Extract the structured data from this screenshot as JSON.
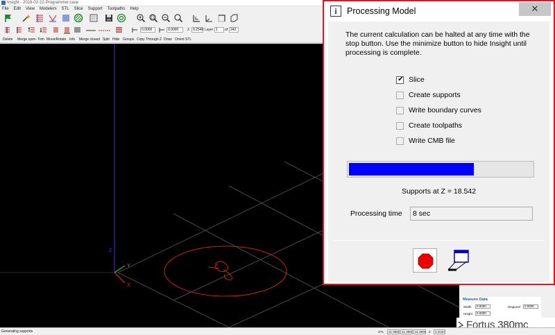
{
  "app": {
    "title": "Insight - 2018-02-22-Programmer.case",
    "menu": [
      "File",
      "Edit",
      "View",
      "Modelers",
      "STL",
      "Slice",
      "Support",
      "Toolpaths",
      "Help"
    ],
    "toolbar2": {
      "field1": "0.0000",
      "field2": "0.0000",
      "z_label": "Z",
      "z_value": "0.2540",
      "layer_label": "Layer",
      "layer_value": "1",
      "of_label": "of",
      "of_value": "242"
    },
    "toolbar3": [
      "Delete",
      "Merge open",
      "Trim",
      "Move/Rotate",
      "Info",
      "Merge closed",
      "Split",
      "Hide",
      "Groups",
      "Copy Through Z",
      "Draw",
      "Orient STL"
    ],
    "viewport": {
      "axis_x": "X",
      "axis_y": "Y",
      "axis_z": "Z",
      "colors": {
        "background": "#000000",
        "grid": "#5a5a5a",
        "part": "#cc1f1f",
        "axis_x": "#d12a2a",
        "axis_y": "#28c428",
        "axis_z": "#2f3fd8"
      }
    },
    "status": {
      "text": "Generating supports",
      "stl_label": "STL",
      "v1": "31.9980",
      "v2": "31.9980",
      "v3": "31.9999",
      "z_label": "Z",
      "z_value": "0.2540"
    },
    "measure": {
      "title": "Measure Data",
      "width_label": "Width",
      "width_value": "0.0000",
      "height_label": "Height",
      "height_value": "0.0000",
      "diagonal_label": "Diagonal",
      "diagonal_value": "0.0000"
    },
    "brand": {
      "name": "Fortus",
      "model": "380mc"
    }
  },
  "dialog": {
    "title": "Processing Model",
    "close_icon": "close-icon",
    "message": "The current  calculation can be halted at any time with the stop button. Use  the minimize button to hide Insight until processing  is complete.",
    "steps": [
      {
        "label": "Slice",
        "checked": true,
        "enabled": true
      },
      {
        "label": "Create supports",
        "checked": false,
        "enabled": false
      },
      {
        "label": "Write boundary curves",
        "checked": false,
        "enabled": false
      },
      {
        "label": "Create toolpaths",
        "checked": false,
        "enabled": false
      },
      {
        "label": "Write CMB file",
        "checked": false,
        "enabled": false
      }
    ],
    "progress_fraction": 0.68,
    "progress_color": "#0000ff",
    "status_text": "Supports at Z = 18.542",
    "processing_time_label": "Processing time",
    "processing_time_value": "8 sec",
    "stop_icon": "stop-octagon-icon",
    "minimize_icon": "minimize-window-icon"
  }
}
